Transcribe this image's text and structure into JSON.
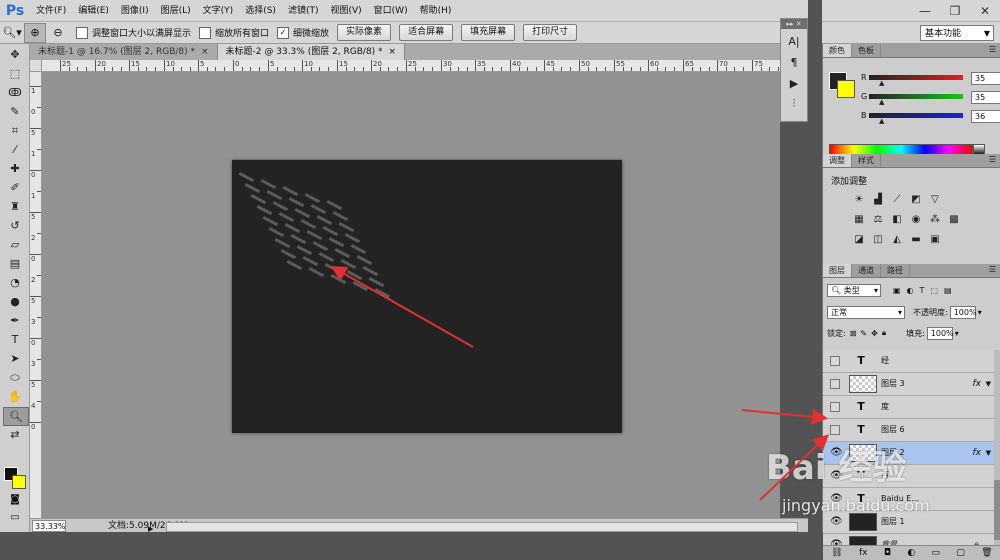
{
  "app": {
    "logo": "Ps"
  },
  "menu": [
    "文件(F)",
    "编辑(E)",
    "图像(I)",
    "图层(L)",
    "文字(Y)",
    "选择(S)",
    "滤镜(T)",
    "视图(V)",
    "窗口(W)",
    "帮助(H)"
  ],
  "options": {
    "checkboxes": [
      {
        "label": "调整窗口大小以满屏显示",
        "checked": false
      },
      {
        "label": "缩放所有窗口",
        "checked": false
      },
      {
        "label": "细微缩放",
        "checked": true
      }
    ],
    "buttons": [
      "实际像素",
      "适合屏幕",
      "填充屏幕",
      "打印尺寸"
    ],
    "workspace": "基本功能"
  },
  "doc_tabs": [
    {
      "title": "未标题-1 @ 16.7% (图层 2, RGB/8) *",
      "active": false
    },
    {
      "title": "未标题-2 @ 33.3% (图层 2, RGB/8) *",
      "active": true
    }
  ],
  "ruler_h_labels": [
    "25",
    "20",
    "15",
    "10",
    "5",
    "0",
    "5",
    "10",
    "15",
    "20",
    "25",
    "30",
    "35",
    "40",
    "45",
    "50",
    "55",
    "60",
    "65",
    "70",
    "75"
  ],
  "ruler_v_labels": [
    "1",
    "0",
    "5",
    "1",
    "0",
    "1",
    "5",
    "2",
    "0",
    "2",
    "5",
    "3",
    "0",
    "3",
    "5",
    "4",
    "0"
  ],
  "status": {
    "zoom": "33.33%",
    "doc_info": "文档:5.09M/26.0M"
  },
  "color_panel": {
    "tabs": [
      "颜色",
      "色板"
    ],
    "channels": [
      {
        "name": "R",
        "value": "35",
        "color": "#e02020"
      },
      {
        "name": "G",
        "value": "35",
        "color": "#20c020"
      },
      {
        "name": "B",
        "value": "36",
        "color": "#2020e0"
      }
    ]
  },
  "adjust_panel": {
    "tabs": [
      "调整",
      "样式"
    ],
    "title": "添加调整"
  },
  "layers_panel": {
    "tabs": [
      "图层",
      "通道",
      "路径"
    ],
    "filter": "类型",
    "blend_mode": "正常",
    "opacity_label": "不透明度:",
    "opacity": "100%",
    "lock_label": "锁定:",
    "fill_label": "填充:",
    "fill": "100%",
    "layers": [
      {
        "name": "经",
        "kind": "text",
        "visible": false,
        "fx": false,
        "selected": false
      },
      {
        "name": "图层 3",
        "kind": "pixel",
        "visible": false,
        "fx": true,
        "selected": false
      },
      {
        "name": "度",
        "kind": "text",
        "visible": false,
        "fx": false,
        "selected": false
      },
      {
        "name": "图层 6",
        "kind": "text",
        "visible": false,
        "fx": false,
        "selected": false
      },
      {
        "name": "图层 2",
        "kind": "pixel",
        "visible": true,
        "fx": true,
        "selected": true
      },
      {
        "name": "百",
        "kind": "text",
        "visible": true,
        "fx": false,
        "selected": false
      },
      {
        "name": "Baidu E...",
        "kind": "text",
        "visible": true,
        "fx": false,
        "selected": false
      },
      {
        "name": "图层 1",
        "kind": "dark",
        "visible": true,
        "fx": false,
        "selected": false
      },
      {
        "name": "背景",
        "kind": "dark",
        "visible": true,
        "fx": false,
        "selected": false,
        "locked": true
      }
    ],
    "fx_label": "fx"
  },
  "watermark": {
    "text": "Bai 经验",
    "url": "jingyan.baidu.com"
  },
  "colors": {
    "arrow": "#e03030",
    "canvas": "#232323",
    "selected_layer": "#a9c5ee"
  }
}
